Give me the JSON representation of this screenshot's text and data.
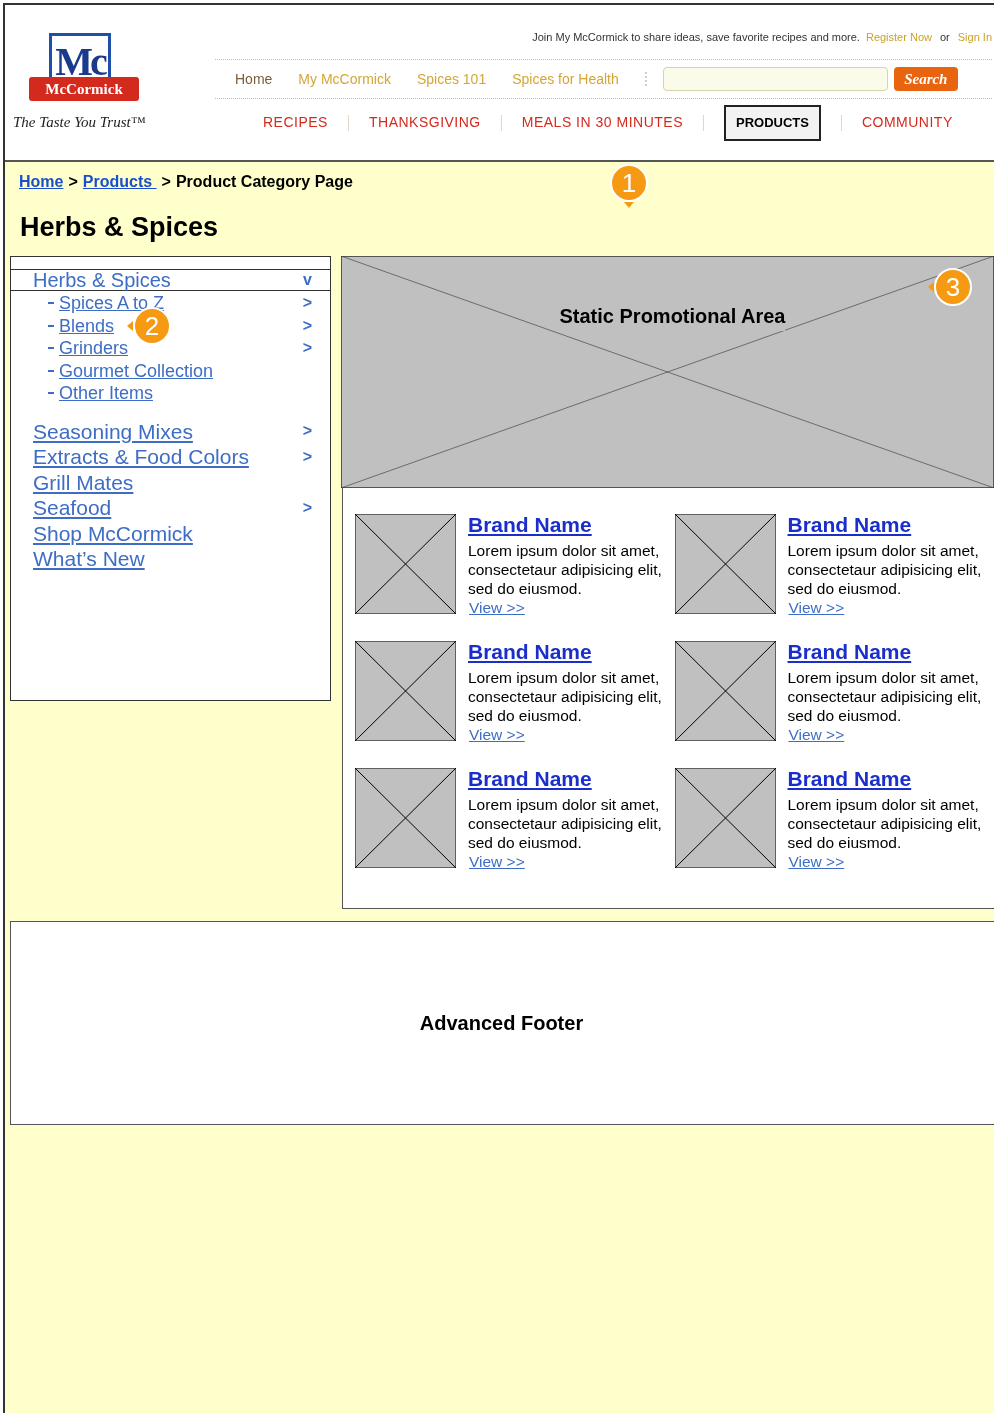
{
  "logo": {
    "monogram": "Mc",
    "ribbon": "McCormick",
    "tagline": "The Taste You Trust™"
  },
  "header": {
    "join_text": "Join My McCormick to share ideas, save favorite recipes and more.",
    "register": "Register Now",
    "or": "or",
    "sign_in": "Sign In",
    "nav": [
      {
        "label": "Home",
        "selected": true
      },
      {
        "label": "My McCormick",
        "selected": false
      },
      {
        "label": "Spices 101",
        "selected": false
      },
      {
        "label": "Spices for Health",
        "selected": false
      }
    ],
    "search": {
      "button": "Search"
    },
    "categories": [
      {
        "label": "RECIPES",
        "selected": false
      },
      {
        "label": "THANKSGIVING",
        "selected": false
      },
      {
        "label": "MEALS IN 30 MINUTES",
        "selected": false
      },
      {
        "label": "PRODUCTS",
        "selected": true
      },
      {
        "label": "COMMUNITY",
        "selected": false
      }
    ]
  },
  "breadcrumb": [
    {
      "label": "Home",
      "kind": "link"
    },
    {
      "label": "Products ",
      "kind": "link"
    },
    {
      "label": "Product Category Page",
      "kind": "current"
    }
  ],
  "separator": ">",
  "title": "Herbs & Spices",
  "annotations": [
    "1",
    "2",
    "3"
  ],
  "sidebar": [
    {
      "label": "Herbs & Spices",
      "chevron": "v",
      "expanded": true,
      "children": [
        {
          "label": "Spices A to Z",
          "chevron": ">"
        },
        {
          "label": "Blends",
          "chevron": ">"
        },
        {
          "label": "Grinders",
          "chevron": ">"
        },
        {
          "label": "Gourmet Collection"
        },
        {
          "label": "Other Items"
        }
      ]
    },
    {
      "label": "Seasoning Mixes",
      "chevron": ">",
      "expanded": false
    },
    {
      "label": "Extracts & Food Colors",
      "chevron": ">",
      "expanded": false
    },
    {
      "label": "Grill Mates",
      "expanded": false
    },
    {
      "label": "Seafood",
      "chevron": ">",
      "expanded": false
    },
    {
      "label": "Shop McCormick",
      "expanded": false
    },
    {
      "label": "What’s New",
      "expanded": false
    }
  ],
  "promo": {
    "label": "Static Promotional Area"
  },
  "products": [
    {
      "name": "Brand Name",
      "description": "Lorem ipsum dolor sit amet, consectetaur adipisicing elit, sed do eiusmod.",
      "link": "View >>"
    },
    {
      "name": "Brand Name",
      "description": "Lorem ipsum dolor sit amet, consectetaur adipisicing elit, sed do eiusmod.",
      "link": "View >>"
    },
    {
      "name": "Brand Name",
      "description": "Lorem ipsum dolor sit amet, consectetaur adipisicing elit, sed do eiusmod.",
      "link": "View >>"
    },
    {
      "name": "Brand Name",
      "description": "Lorem ipsum dolor sit amet, consectetaur adipisicing elit, sed do eiusmod.",
      "link": "View >>"
    },
    {
      "name": "Brand Name",
      "description": "Lorem ipsum dolor sit amet, consectetaur adipisicing elit, sed do eiusmod.",
      "link": "View >>"
    },
    {
      "name": "Brand Name",
      "description": "Lorem ipsum dolor sit amet, consectetaur adipisicing elit, sed do eiusmod.",
      "link": "View >>"
    }
  ],
  "footer": {
    "label": "Advanced Footer"
  }
}
